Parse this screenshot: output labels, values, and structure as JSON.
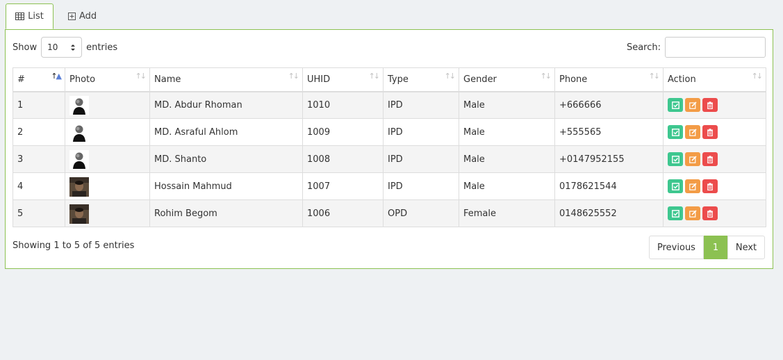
{
  "tabs": [
    {
      "label": "List",
      "icon": "table-icon",
      "active": true
    },
    {
      "label": "Add",
      "icon": "plus-square-icon",
      "active": false
    }
  ],
  "length": {
    "prefix": "Show",
    "value": "10",
    "suffix": "entries"
  },
  "search": {
    "label": "Search:",
    "value": ""
  },
  "table": {
    "headers": [
      "#",
      "Photo",
      "Name",
      "UHID",
      "Type",
      "Gender",
      "Phone",
      "Action"
    ],
    "sorted_column": "#",
    "rows": [
      {
        "num": "1",
        "photo": "avatar-placeholder",
        "name": "MD. Abdur Rhoman",
        "uhid": "1010",
        "type": "IPD",
        "gender": "Male",
        "phone": "+666666"
      },
      {
        "num": "2",
        "photo": "avatar-placeholder",
        "name": "MD. Asraful Ahlom",
        "uhid": "1009",
        "type": "IPD",
        "gender": "Male",
        "phone": "+555565"
      },
      {
        "num": "3",
        "photo": "avatar-placeholder",
        "name": "MD. Shanto",
        "uhid": "1008",
        "type": "IPD",
        "gender": "Male",
        "phone": "+0147952155"
      },
      {
        "num": "4",
        "photo": "photo",
        "name": "Hossain Mahmud",
        "uhid": "1007",
        "type": "IPD",
        "gender": "Male",
        "phone": "0178621544"
      },
      {
        "num": "5",
        "photo": "photo",
        "name": "Rohim Begom",
        "uhid": "1006",
        "type": "OPD",
        "gender": "Female",
        "phone": "0148625552"
      }
    ]
  },
  "info": "Showing 1 to 5 of 5 entries",
  "pagination": {
    "previous": "Previous",
    "current": "1",
    "next": "Next"
  },
  "colors": {
    "accent": "#8cc152",
    "view": "#3ec78f",
    "edit": "#f39c46",
    "delete": "#ec4c4c"
  }
}
